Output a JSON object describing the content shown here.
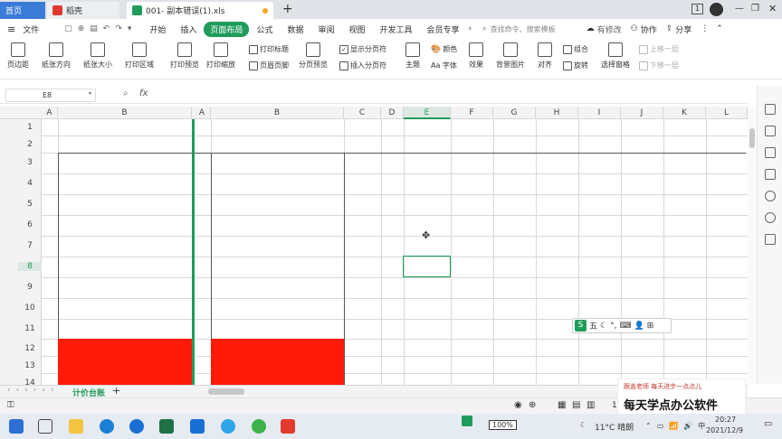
{
  "titlebar": {
    "tab_home": "首页",
    "tab_daoke": "稻壳",
    "tab_doc": "001- 副本错误(1).xls",
    "new_tab": "+",
    "window_badge": "1"
  },
  "menubar": {
    "file": "文件",
    "items": [
      "开始",
      "插入",
      "页面布局",
      "公式",
      "数据",
      "审阅",
      "视图",
      "开发工具",
      "会员专享"
    ],
    "search_placeholder": "查找命令、搜索模板",
    "edit_state": "有修改",
    "collab": "协作",
    "share": "分享"
  },
  "ribbon": {
    "margins": "页边距",
    "orientation": "纸张方向",
    "size": "纸张大小",
    "print_area": "打印区域",
    "print_preview": "打印预览",
    "print_scale": "打印缩放",
    "print_titles": "打印标题",
    "header_footer": "页眉页脚",
    "page_break_preview": "分页预览",
    "show_page_break": "显示分页符",
    "insert_page_break": "插入分页符",
    "theme": "主题",
    "colors": "颜色",
    "fonts": "Aa 字体",
    "effects": "效果",
    "background": "背景图片",
    "align": "对齐",
    "group": "组合",
    "rotate": "旋转",
    "select_pane": "选择窗格",
    "bring_forward": "上移一层",
    "send_backward": "下移一层"
  },
  "formula_bar": {
    "name_box": "E8",
    "fx": "fx",
    "formula": ""
  },
  "columns": [
    "A",
    "B",
    "A",
    "B",
    "C",
    "D",
    "E",
    "F",
    "G",
    "H",
    "I",
    "J",
    "K",
    "L"
  ],
  "rows": [
    "1",
    "2",
    "3",
    "4",
    "5",
    "6",
    "7",
    "8",
    "9",
    "10",
    "11",
    "12",
    "13",
    "14"
  ],
  "selected_cell": "E8",
  "sheet_tabs": {
    "active": "计价台账",
    "add": "+"
  },
  "floatbar": {
    "items": [
      "五",
      "☾",
      "°,",
      "⌨",
      "👤",
      "⊞"
    ]
  },
  "status": {
    "zoom": "10"
  },
  "watermark": {
    "line1": "跟盖老师  每天进步一点点儿",
    "line2": "每天学点办公软件"
  },
  "taskbar": {
    "battery": "100%",
    "weather": "11°C 晴朗",
    "time": "20:27",
    "date": "2021/12/9"
  },
  "colors": {
    "accent": "#1f9c5a",
    "red_fill": "#ff1a0a",
    "freeze_line": "#1f9c5a",
    "select": "#1f9c5a"
  }
}
